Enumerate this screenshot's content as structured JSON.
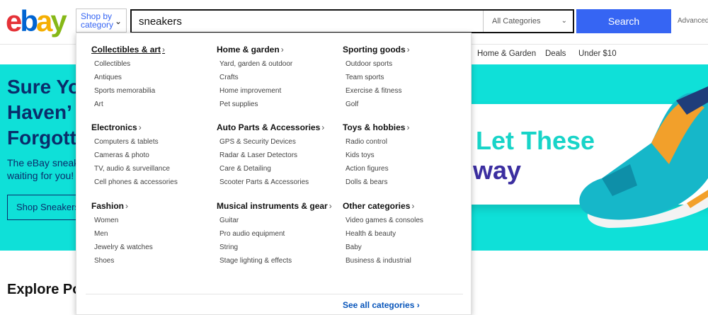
{
  "header": {
    "logo_letters": [
      {
        "char": "e",
        "color": "#e53238"
      },
      {
        "char": "b",
        "color": "#0064d2"
      },
      {
        "char": "a",
        "color": "#f5af02"
      },
      {
        "char": "y",
        "color": "#86b817"
      }
    ],
    "shop_by_label": "Shop by category",
    "search_value": "sneakers",
    "category_select": "All Categories",
    "search_button": "Search",
    "advanced_link": "Advanced"
  },
  "nav": {
    "items": [
      "Home & Garden",
      "Deals",
      "Under $10"
    ]
  },
  "hero": {
    "title_lines": [
      "Sure Yo",
      "Haven’",
      "Forgott"
    ],
    "subtitle_lines": [
      "The eBay sneak",
      "waiting for you!"
    ],
    "button": "Shop Sneakers",
    "banner_line1": "Let These",
    "banner_line2": "way",
    "colors": {
      "background": "#0fe0d8",
      "text": "#0a2d6b",
      "banner_teal": "#18d4c8",
      "banner_purple": "#3b2ea0"
    }
  },
  "explore_heading": "Explore Po",
  "dropdown": {
    "columns": [
      {
        "groups": [
          {
            "title": "Collectibles & art",
            "items": [
              "Collectibles",
              "Antiques",
              "Sports memorabilia",
              "Art"
            ]
          },
          {
            "title": "Electronics",
            "items": [
              "Computers & tablets",
              "Cameras & photo",
              "TV, audio & surveillance",
              "Cell phones & accessories"
            ]
          },
          {
            "title": "Fashion",
            "items": [
              "Women",
              "Men",
              "Jewelry & watches",
              "Shoes"
            ]
          }
        ]
      },
      {
        "groups": [
          {
            "title": "Home & garden",
            "items": [
              "Yard, garden & outdoor",
              "Crafts",
              "Home improvement",
              "Pet supplies"
            ]
          },
          {
            "title": "Auto Parts & Accessories",
            "items": [
              "GPS & Security Devices",
              "Radar & Laser Detectors",
              "Care & Detailing",
              "Scooter Parts & Accessories"
            ]
          },
          {
            "title": "Musical instruments & gear",
            "items": [
              "Guitar",
              "Pro audio equipment",
              "String",
              "Stage lighting & effects"
            ]
          }
        ]
      },
      {
        "groups": [
          {
            "title": "Sporting goods",
            "items": [
              "Outdoor sports",
              "Team sports",
              "Exercise & fitness",
              "Golf"
            ]
          },
          {
            "title": "Toys & hobbies",
            "items": [
              "Radio control",
              "Kids toys",
              "Action figures",
              "Dolls & bears"
            ]
          },
          {
            "title": "Other categories",
            "items": [
              "Video games & consoles",
              "Health & beauty",
              "Baby",
              "Business & industrial"
            ]
          }
        ]
      }
    ],
    "see_all": "See all categories"
  }
}
